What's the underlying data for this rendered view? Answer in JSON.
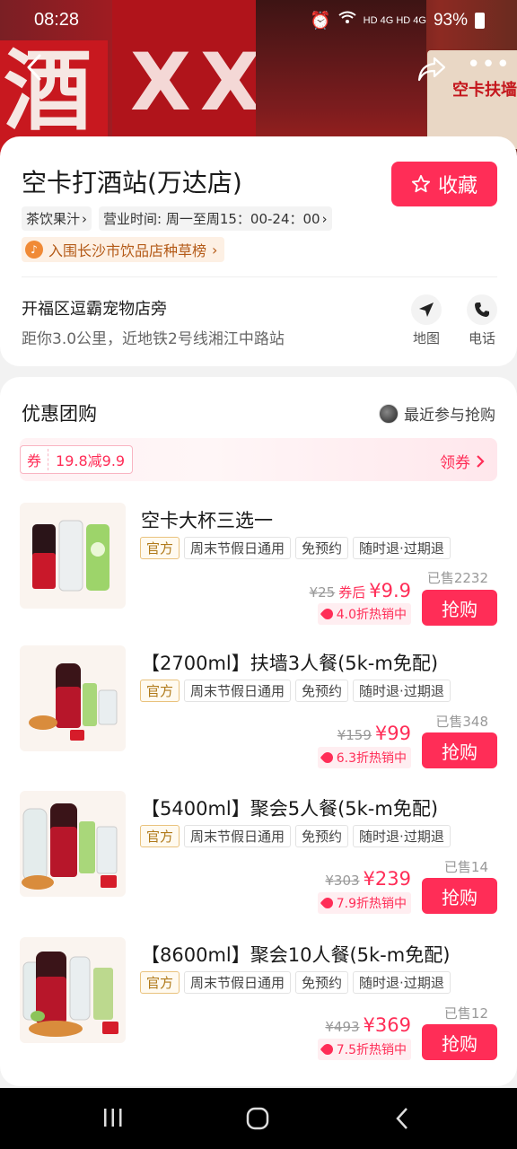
{
  "status_bar": {
    "time": "08:28",
    "battery": "93%",
    "network": "HD 4G HD 4G"
  },
  "hero": {
    "sign_char": "酒",
    "sign_mark": "XX",
    "sign_right_text": "空卡扶墙"
  },
  "shop": {
    "name": "空卡打酒站(万达店)",
    "favorite_label": "收藏",
    "category": "茶饮果汁",
    "hours": "营业时间: 周一至周15：00-24：00",
    "ranking": "入围长沙市饮品店种草榜",
    "address": "开福区逗霸宠物店旁",
    "distance": "距你3.0公里，近地铁2号线湘江中路站",
    "map_label": "地图",
    "phone_label": "电话"
  },
  "deals_section": {
    "title": "优惠团购",
    "recent_label": "最近参与抢购",
    "coupon_tag": "券",
    "coupon_amount": "19.8减9.9",
    "get_coupon": "领券"
  },
  "deals": [
    {
      "title": "空卡大杯三选一",
      "chips": [
        "官方",
        "周末节假日通用",
        "免预约",
        "随时退·过期退"
      ],
      "sold": "已售2232",
      "original_price": "¥25",
      "price_prefix": "券后",
      "price": "¥9.9",
      "hot": "4.0折热销中",
      "buy": "抢购"
    },
    {
      "title": "【2700ml】扶墙3人餐(5k-m免配)",
      "chips": [
        "官方",
        "周末节假日通用",
        "免预约",
        "随时退·过期退"
      ],
      "sold": "已售348",
      "original_price": "¥159",
      "price_prefix": "",
      "price": "¥99",
      "hot": "6.3折热销中",
      "buy": "抢购"
    },
    {
      "title": "【5400ml】聚会5人餐(5k-m免配)",
      "chips": [
        "官方",
        "周末节假日通用",
        "免预约",
        "随时退·过期退"
      ],
      "sold": "已售14",
      "original_price": "¥303",
      "price_prefix": "",
      "price": "¥239",
      "hot": "7.9折热销中",
      "buy": "抢购"
    },
    {
      "title": "【8600ml】聚会10人餐(5k-m免配)",
      "chips": [
        "官方",
        "周末节假日通用",
        "免预约",
        "随时退·过期退"
      ],
      "sold": "已售12",
      "original_price": "¥493",
      "price_prefix": "",
      "price": "¥369",
      "hot": "7.5折热销中",
      "buy": "抢购"
    }
  ],
  "colors": {
    "accent": "#ff2d57",
    "official": "#b07a1a",
    "rank": "#b45a17"
  },
  "icons": [
    "back-arrow-icon",
    "share-icon",
    "more-icon",
    "star-icon",
    "map-pin-icon",
    "phone-icon",
    "music-rank-icon",
    "chevron-right-icon",
    "hot-tag-icon",
    "recents-icon",
    "home-icon",
    "back-icon"
  ]
}
